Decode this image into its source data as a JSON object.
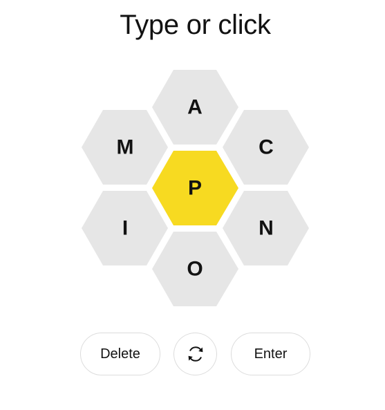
{
  "title": "Type or click",
  "letters": {
    "center": "P",
    "top": "A",
    "upper_left": "M",
    "upper_right": "C",
    "lower_left": "I",
    "lower_right": "N",
    "bottom": "O"
  },
  "buttons": {
    "delete_label": "Delete",
    "shuffle_icon": "shuffle-icon",
    "enter_label": "Enter"
  },
  "colors": {
    "center_cell": "#f7da21",
    "outer_cell": "#e6e6e6",
    "text": "#121212"
  }
}
